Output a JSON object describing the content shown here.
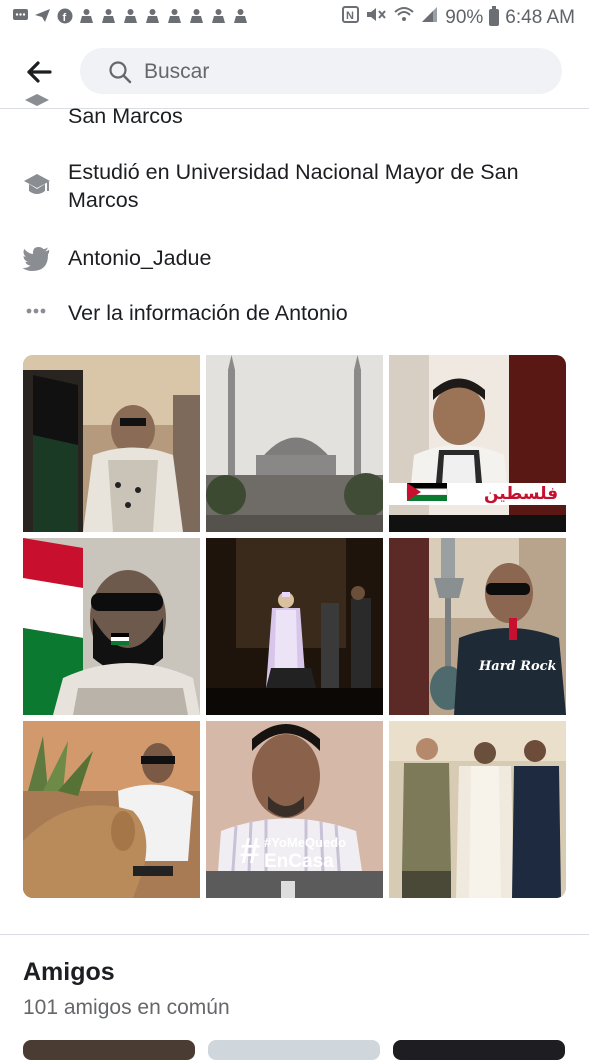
{
  "status_bar": {
    "battery": "90%",
    "time": "6:48 AM",
    "icons": [
      "message-icon",
      "send-icon",
      "facebook-icon",
      "person-icon",
      "person-icon",
      "person-icon",
      "person-icon",
      "person-icon",
      "person-icon",
      "person-icon",
      "person-icon",
      "nfc-icon",
      "mute-icon",
      "wifi-icon",
      "signal-icon",
      "battery-icon"
    ]
  },
  "header": {
    "search_placeholder": "Buscar"
  },
  "about": {
    "partial_line": "San Marcos",
    "education": "Estudió en Universidad Nacional Mayor de San Marcos",
    "twitter": "Antonio_Jadue",
    "more_info": "Ver la información de Antonio"
  },
  "photos": {
    "overlay_text_1": "فلسطين",
    "overlay_text_2": "#YoMeQuedo",
    "overlay_text_3": "EnCasa",
    "shirt_text": "Hard Rock"
  },
  "friends": {
    "title": "Amigos",
    "count": "101 amigos en común"
  },
  "colors": {
    "primary_text": "#1c1e21",
    "secondary_text": "#65676b",
    "search_bg": "#f0f2f5",
    "icon_gray": "#8a8d91"
  }
}
